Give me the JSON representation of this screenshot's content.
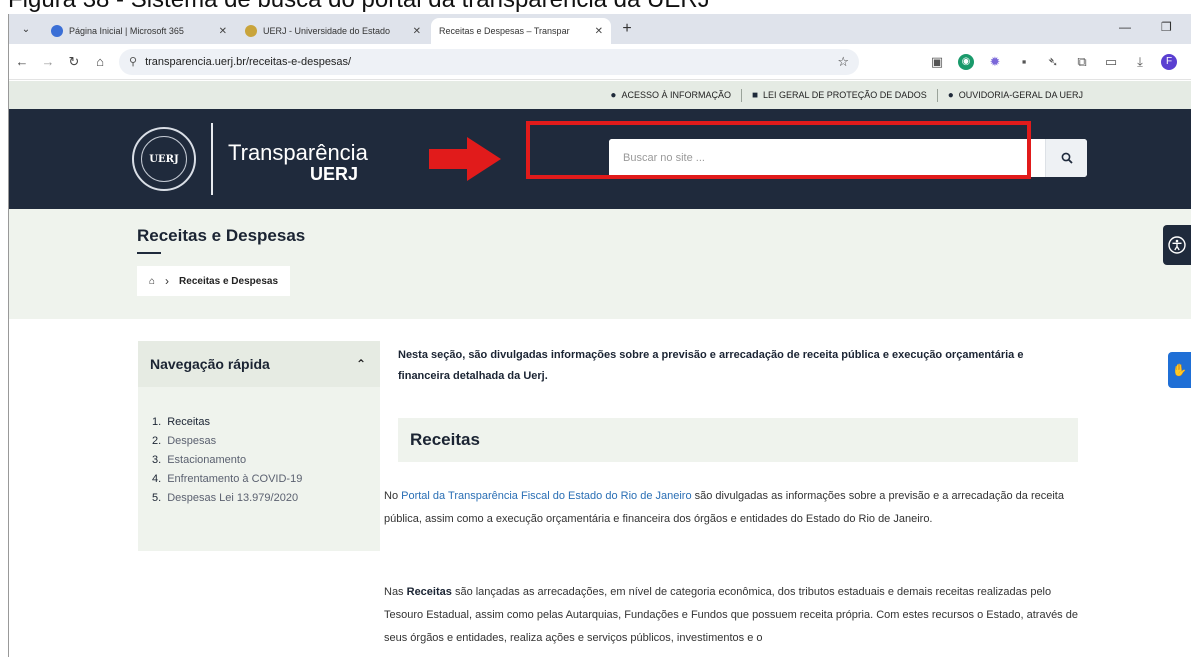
{
  "caption": "Figura 38 - Sistema de busca do portal da transparência da UERJ",
  "browser": {
    "tabs": [
      {
        "title": "Página Inicial | Microsoft 365",
        "favicon_color": "#3b6fd6",
        "active": false
      },
      {
        "title": "UERJ - Universidade do Estado",
        "favicon_color": "#c9a43b",
        "active": false
      },
      {
        "title": "Receitas e Despesas – Transpar",
        "favicon_color": "#ffffff",
        "active": true
      }
    ],
    "new_tab": "+",
    "address": "transparencia.uerj.br/receitas-e-despesas/",
    "profile_initial": "F",
    "colors": {
      "tabstrip": "#dfe3eb",
      "omnibox": "#eef1f6",
      "profile": "#5a3fd1"
    }
  },
  "utility_bar": {
    "items": [
      {
        "icon": "chat-bubble-icon",
        "label": "ACESSO À INFORMAÇÃO"
      },
      {
        "icon": "lock-icon",
        "label": "LEI GERAL DE PROTEÇÃO DE DADOS"
      },
      {
        "icon": "chat-group-icon",
        "label": "OUVIDORIA-GERAL DA UERJ"
      }
    ]
  },
  "header": {
    "seal_text": "UERJ",
    "brand_name": "Transparência",
    "brand_sub": "UERJ",
    "search": {
      "placeholder": "Buscar no site ..."
    },
    "colors": {
      "background": "#1f2a3c",
      "highlight": "#e11b1b"
    }
  },
  "title_band": {
    "title": "Receitas e Despesas",
    "breadcrumb": {
      "home_icon": "home-icon",
      "current": "Receitas e Despesas"
    }
  },
  "quick_nav": {
    "heading": "Navegação rápida",
    "items": [
      {
        "num": "1.",
        "label": "Receitas"
      },
      {
        "num": "2.",
        "label": "Despesas"
      },
      {
        "num": "3.",
        "label": "Estacionamento"
      },
      {
        "num": "4.",
        "label": "Enfrentamento à COVID-19"
      },
      {
        "num": "5.",
        "label": "Despesas Lei 13.979/2020"
      }
    ]
  },
  "content": {
    "intro": "Nesta seção, são divulgadas informações sobre a previsão e arrecadação de receita pública e execução orçamentária e financeira detalhada da Uerj.",
    "section_title": "Receitas",
    "para1_pre": "No ",
    "para1_link": "Portal da Transparência Fiscal do Estado do Rio de Janeiro",
    "para1_post": " são divulgadas as informações sobre a previsão e a arrecadação da receita pública, assim como a execução orçamentária e financeira dos órgãos e entidades do Estado do Rio de Janeiro.",
    "para2_pre": "Nas ",
    "para2_bold": "Receitas",
    "para2_post": " são lançadas as arrecadações, em nível de categoria econômica, dos tributos estaduais e demais receitas realizadas pelo Tesouro Estadual, assim como pelas Autarquias, Fundações e Fundos que possuem receita própria. Com estes recursos o Estado, através de seus órgãos e entidades, realiza ações e serviços públicos, investimentos e o"
  }
}
